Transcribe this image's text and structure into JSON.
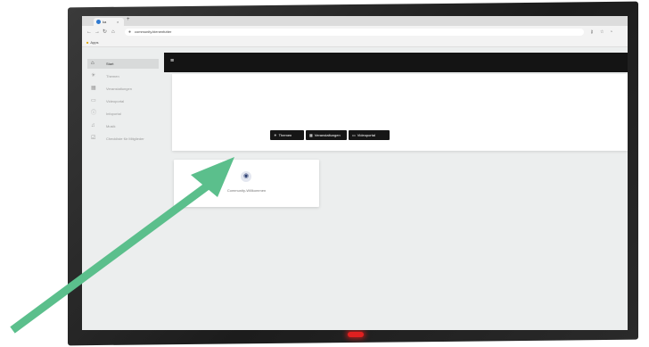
{
  "browser": {
    "tab_title": "ka",
    "tab_close": "×",
    "new_tab": "+",
    "url": "community.bienenfutter",
    "bookmark_label": "Apps"
  },
  "header": {
    "menu_glyph": "≡"
  },
  "sidebar": {
    "items": [
      {
        "label": "Start",
        "icon": "home-icon",
        "glyph": "⌂"
      },
      {
        "label": "Themen",
        "icon": "lightbulb-icon",
        "glyph": "☀"
      },
      {
        "label": "Veranstaltungen",
        "icon": "calendar-grid-icon",
        "glyph": "▦"
      },
      {
        "label": "Videoportal",
        "icon": "video-icon",
        "glyph": "▭"
      },
      {
        "label": "Infoportal",
        "icon": "info-icon",
        "glyph": "ⓘ"
      },
      {
        "label": "Musik",
        "icon": "music-icon",
        "glyph": "♫"
      },
      {
        "label": "Checkliste für Mitglieder",
        "icon": "checklist-icon",
        "glyph": "☑"
      }
    ]
  },
  "hero": {
    "buttons": [
      {
        "label": "Themen",
        "icon": "lightbulb-icon",
        "glyph": "☀"
      },
      {
        "label": "Veranstaltungen",
        "icon": "calendar-icon",
        "glyph": "▦"
      },
      {
        "label": "Videoportal",
        "icon": "video-icon",
        "glyph": "▭"
      }
    ]
  },
  "card": {
    "label": "Community-Willkommen",
    "icon": "community-icon",
    "glyph": "◉"
  },
  "annotation": {
    "arrow_color": "#5bbf8c"
  }
}
